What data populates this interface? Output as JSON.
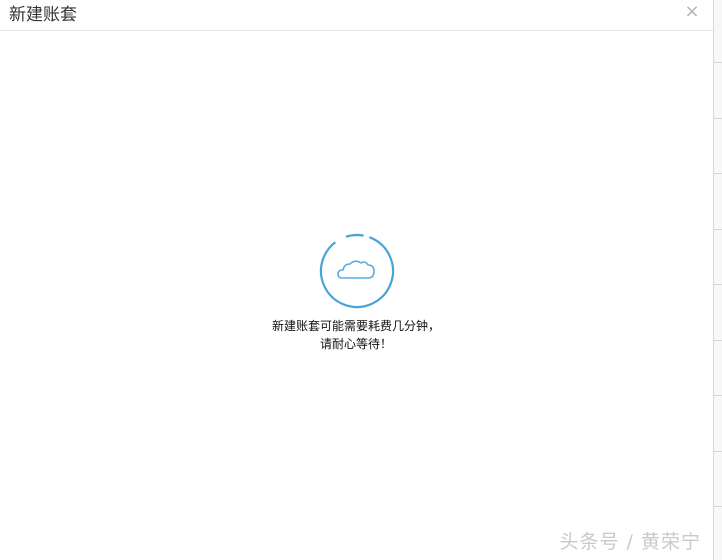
{
  "dialog": {
    "title": "新建账套",
    "close_icon": "close-icon",
    "close_label": "×"
  },
  "loading": {
    "icon": "cloud-icon",
    "spinner_color": "#4aa3d8",
    "line1": "新建账套可能需要耗费几分钟，",
    "line2": "请耐心等待！"
  },
  "watermark": {
    "text": "头条号 / 黄荣宁"
  }
}
